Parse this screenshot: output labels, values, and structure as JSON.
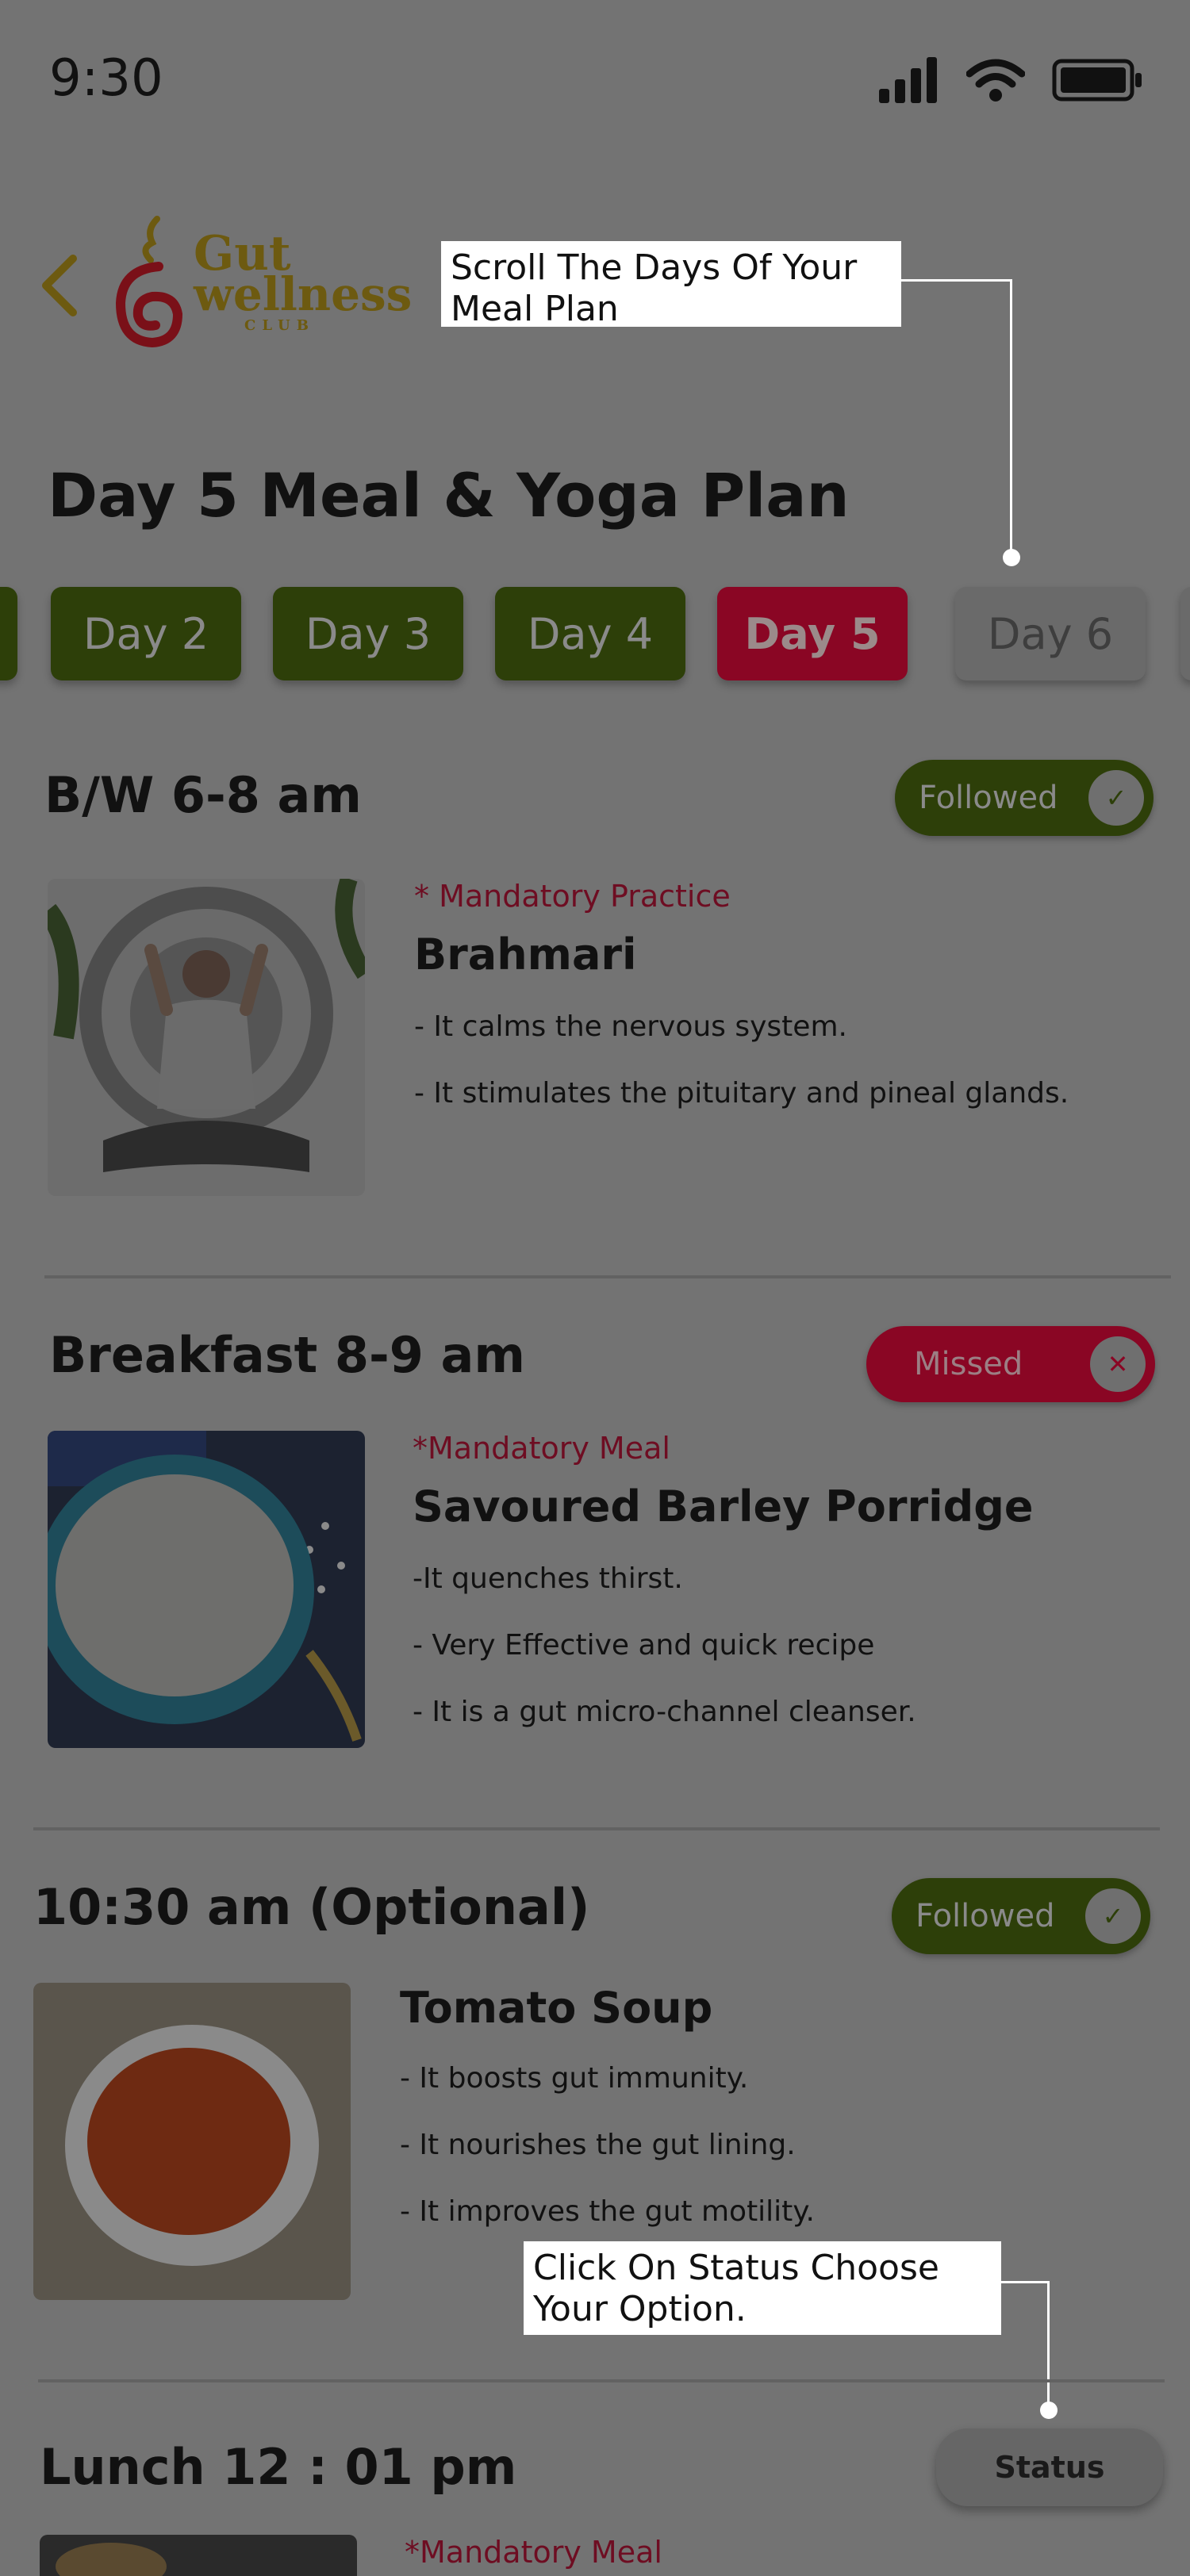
{
  "status_bar": {
    "time": "9:30"
  },
  "logo": {
    "line1": "Gut",
    "line2": "wellness",
    "line3": "CLUB"
  },
  "tooltips": {
    "scroll_days": "Scroll The Days Of Your Meal Plan",
    "click_status": "Click On Status Choose Your Option."
  },
  "page_title": "Day 5 Meal & Yoga Plan",
  "days": [
    {
      "label": "Day 2",
      "state": "done"
    },
    {
      "label": "Day 3",
      "state": "done"
    },
    {
      "label": "Day 4",
      "state": "done"
    },
    {
      "label": "Day 5",
      "state": "active"
    },
    {
      "label": "Day 6",
      "state": "future"
    }
  ],
  "slots": [
    {
      "title": "B/W 6-8 am",
      "status": "Followed",
      "mandatory": "* Mandatory Practice",
      "item": "Brahmari",
      "bullets": [
        "- It calms the nervous system.",
        "- It stimulates the pituitary and pineal glands."
      ]
    },
    {
      "title": "Breakfast 8-9 am",
      "status": "Missed",
      "mandatory": "*Mandatory Meal",
      "item": "Savoured Barley Porridge",
      "bullets": [
        "-It quenches thirst.",
        "- Very Effective and quick recipe",
        "- It is a gut micro-channel cleanser."
      ]
    },
    {
      "title": "10:30 am (Optional)",
      "status": "Followed",
      "item": "Tomato Soup",
      "bullets": [
        "- It boosts gut immunity.",
        "- It nourishes the gut lining.",
        "- It improves the gut motility."
      ]
    },
    {
      "title": "Lunch 12 : 01 pm",
      "status": "Status",
      "mandatory": "*Mandatory Meal"
    }
  ],
  "colors": {
    "followed": "#2d3f09",
    "missed": "#8a0624",
    "overlay_bg": "#737373"
  }
}
